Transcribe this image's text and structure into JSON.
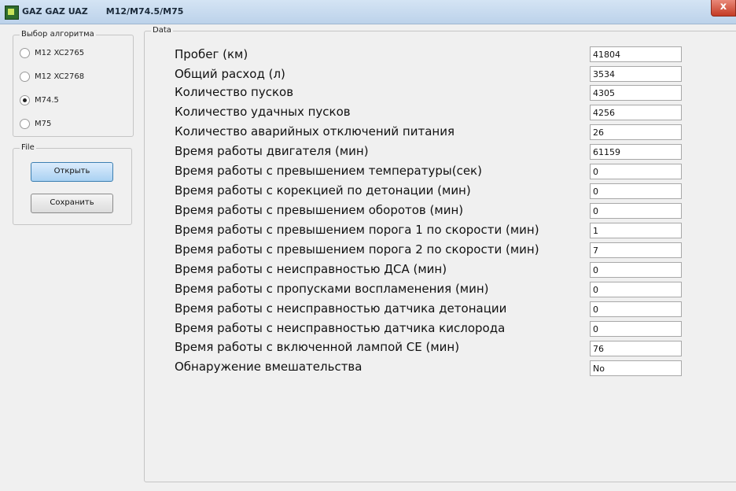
{
  "window": {
    "title": "GAZ GAZ UAZ      M12/M74.5/M75",
    "close_glyph": "x",
    "app_icon": "chip-icon"
  },
  "algorithm_group": {
    "legend": "Выбор алгоритма",
    "options": [
      {
        "label": "M12  XC2765",
        "checked": false
      },
      {
        "label": "M12  XC2768",
        "checked": false
      },
      {
        "label": "M74.5",
        "checked": true
      },
      {
        "label": "M75",
        "checked": false
      }
    ]
  },
  "file_group": {
    "legend": "File",
    "open_label": "Открыть",
    "save_label": "Сохранить"
  },
  "data_group": {
    "legend": "Data",
    "rows": [
      {
        "label": "Пробег (км)",
        "value": "41804"
      },
      {
        "label": "Общий расход (л)",
        "value": "3534"
      },
      {
        "label": "Количество пусков",
        "value": "4305"
      },
      {
        "label": "Количество удачных пусков",
        "value": "4256"
      },
      {
        "label": "Количество аварийных отключений питания",
        "value": "26"
      },
      {
        "label": "Время работы двигателя (мин)",
        "value": "61159"
      },
      {
        "label": "Время работы с превышением температуры(сек)",
        "value": "0"
      },
      {
        "label": "Время работы с корекцией по детонации (мин)",
        "value": "0"
      },
      {
        "label": "Время работы с превышением оборотов (мин)",
        "value": "0"
      },
      {
        "label": "Время работы с превышением порога 1 по скорости (мин)",
        "value": "1"
      },
      {
        "label": "Время работы с превышением порога 2 по скорости (мин)",
        "value": "7"
      },
      {
        "label": "Время работы с неисправностью ДСА (мин)",
        "value": "0"
      },
      {
        "label": "Время работы с пропусками воспламенения (мин)",
        "value": "0"
      },
      {
        "label": "Время работы с неисправностью датчика детонации",
        "value": "0"
      },
      {
        "label": "Время работы с неисправностью датчика кислорода",
        "value": "0"
      },
      {
        "label": "Время работы с включенной лампой CE (мин)",
        "value": "76"
      },
      {
        "label": "Обнаружение вмешательства",
        "value": "No"
      }
    ]
  }
}
